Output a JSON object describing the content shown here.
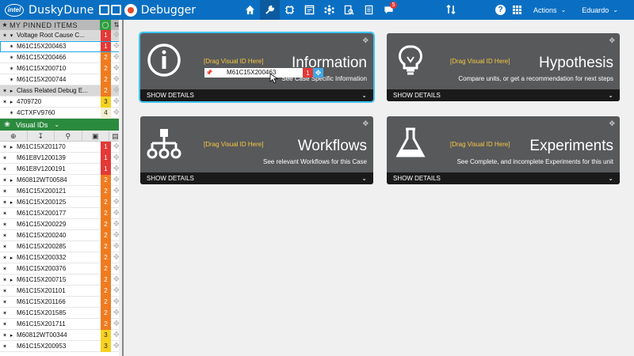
{
  "header": {
    "logo_text": "intel",
    "app_title": "DuskyDune",
    "section_title": "Debugger",
    "nav_icons": [
      "home-icon",
      "wrench-icon",
      "chip-icon",
      "window-icon",
      "network-icon",
      "search-doc-icon",
      "document-icon",
      "notifications-icon"
    ],
    "notification_count": "5",
    "actions_label": "Actions",
    "user_label": "Eduardo"
  },
  "sidebar": {
    "pinned_title": "MY PINNED ITEMS",
    "pinned_rows": [
      {
        "label": "Voltage Root Cause C...",
        "num": "1",
        "level": "c1",
        "group": true,
        "expanded": true
      },
      {
        "label": "M61C15X200463",
        "num": "1",
        "level": "c1",
        "group": false,
        "selected": true
      },
      {
        "label": "M61C15X200466",
        "num": "2",
        "level": "c2",
        "group": false
      },
      {
        "label": "M61C15X200710",
        "num": "2",
        "level": "c2",
        "group": false
      },
      {
        "label": "M61C15X200744",
        "num": "2",
        "level": "c2",
        "group": false
      },
      {
        "label": "Class Related Debug E...",
        "num": "2",
        "level": "c2",
        "group": true,
        "expanded": false
      },
      {
        "label": "4709720",
        "num": "3",
        "level": "c3",
        "group": false,
        "expander": true
      },
      {
        "label": "4CTXFV9760",
        "num": "4",
        "level": "c4",
        "group": false
      }
    ],
    "visual_ids_title": "Visual IDs",
    "visual_rows": [
      {
        "label": "M61C15X201170",
        "num": "1",
        "level": "c1",
        "expander": true
      },
      {
        "label": "M61E8V1200139",
        "num": "1",
        "level": "c1",
        "expander": false
      },
      {
        "label": "M61E8V1200191",
        "num": "1",
        "level": "c1",
        "expander": false
      },
      {
        "label": "M60812WT00584",
        "num": "2",
        "level": "c2",
        "expander": true
      },
      {
        "label": "M61C15X200121",
        "num": "2",
        "level": "c2",
        "expander": false
      },
      {
        "label": "M61C15X200125",
        "num": "2",
        "level": "c2",
        "expander": true
      },
      {
        "label": "M61C15X200177",
        "num": "2",
        "level": "c2",
        "expander": false
      },
      {
        "label": "M61C15X200229",
        "num": "2",
        "level": "c2",
        "expander": false
      },
      {
        "label": "M61C15X200240",
        "num": "2",
        "level": "c2",
        "expander": false
      },
      {
        "label": "M61C15X200285",
        "num": "2",
        "level": "c2",
        "expander": false
      },
      {
        "label": "M61C15X200332",
        "num": "2",
        "level": "c2",
        "expander": true
      },
      {
        "label": "M61C15X200376",
        "num": "2",
        "level": "c2",
        "expander": false
      },
      {
        "label": "M61C15X200715",
        "num": "2",
        "level": "c2",
        "expander": true
      },
      {
        "label": "M61C15X201101",
        "num": "2",
        "level": "c2",
        "expander": false
      },
      {
        "label": "M61C15X201166",
        "num": "2",
        "level": "c2",
        "expander": false
      },
      {
        "label": "M61C15X201585",
        "num": "2",
        "level": "c2",
        "expander": false
      },
      {
        "label": "M61C15X201711",
        "num": "2",
        "level": "c2",
        "expander": false
      },
      {
        "label": "M60812WT00344",
        "num": "3",
        "level": "c3",
        "expander": true
      },
      {
        "label": "M61C15X200953",
        "num": "3",
        "level": "c3",
        "expander": false
      }
    ]
  },
  "cards": [
    {
      "title": "Information",
      "drag_label": "[Drag Visual ID Here]",
      "description": "See Case Specific Information",
      "footer": "SHOW DETAILS",
      "icon": "info-icon"
    },
    {
      "title": "Hypothesis",
      "drag_label": "[Drag Visual ID Here]",
      "description": "Compare units, or get a recommendation for next steps",
      "footer": "SHOW DETAILS",
      "icon": "lightbulb-icon"
    },
    {
      "title": "Workflows",
      "drag_label": "[Drag Visual ID Here]",
      "description": "See relevant Workflows for this Case",
      "footer": "SHOW DETAILS",
      "icon": "workflow-icon"
    },
    {
      "title": "Experiments",
      "drag_label": "[Drag Visual ID Here]",
      "description": "See Complete, and incomplete Experiments for this unit",
      "footer": "SHOW DETAILS",
      "icon": "flask-icon"
    }
  ],
  "drag_chip": {
    "label": "M61C15X200463",
    "num": "1"
  },
  "colors": {
    "topbar": "#0a6fc2",
    "card": "#58595b",
    "accent_active": "#3ec3f2",
    "drag_text": "#f5c842",
    "visual_ids_header": "#2a8a3e"
  }
}
